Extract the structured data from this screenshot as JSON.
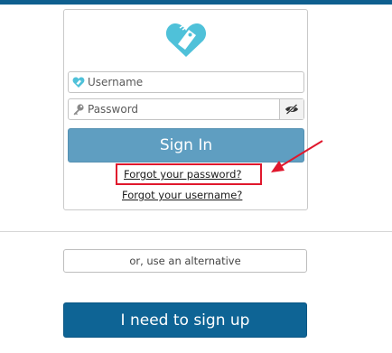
{
  "login": {
    "username_placeholder": "Username",
    "password_placeholder": "Password",
    "signin_label": "Sign In",
    "forgot_password_label": "Forgot your password?",
    "forgot_username_label": "Forgot your username?"
  },
  "alternative": {
    "label": "or, use an alternative"
  },
  "signup": {
    "label": "I need to sign up"
  },
  "colors": {
    "top_bar": "#0f5f8f",
    "logo": "#4fc1d9",
    "signin_button": "#5f9ec1",
    "signup_button": "#0e6495",
    "annotation": "#e0182d"
  },
  "icons": {
    "logo": "heart-tag-logo-icon",
    "username": "heart-icon",
    "password": "key-icon",
    "toggle_password": "eye-slash-icon",
    "annotation": "red-arrow-icon"
  }
}
